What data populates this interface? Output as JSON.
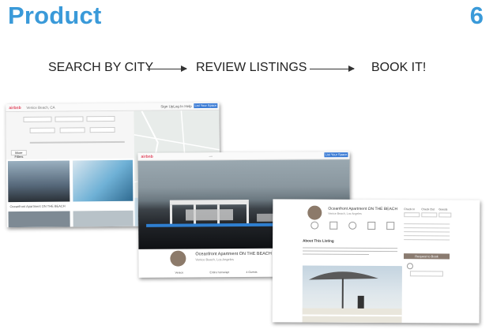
{
  "slide": {
    "title": "Product",
    "number": "6"
  },
  "flow": {
    "steps": [
      "SEARCH BY CITY",
      "REVIEW LISTINGS",
      "BOOK IT!"
    ]
  },
  "search_screen": {
    "brand": "airbnb",
    "search_value": "Venice Beach, CA",
    "nav": [
      "Sign Up",
      "Log In",
      "Help"
    ],
    "cta": "List Your Space",
    "filters_label": "More Filters",
    "listing_title": "Oceanfront Apartment ON THE BEACH"
  },
  "listing_screen": {
    "brand": "airbnb",
    "cta": "List Your Space",
    "listing_title": "Oceanfront Apartment ON THE BEACH",
    "subtitle": "Venice Beach, Los Angeles",
    "amenities": [
      "Venice",
      "Entire home/apt",
      "4 Guests",
      "2 Bedrooms",
      "2 Beds"
    ]
  },
  "book_screen": {
    "listing_title": "Oceanfront Apartment ON THE BEACH",
    "subtitle": "Venice Beach, Los Angeles",
    "section": "About This Listing",
    "book_button": "Request to Book",
    "booking_labels": [
      "Check In",
      "Check Out",
      "Guests"
    ],
    "colors": {
      "accent": "#3a9ad9",
      "brand": "#e0455d"
    }
  }
}
